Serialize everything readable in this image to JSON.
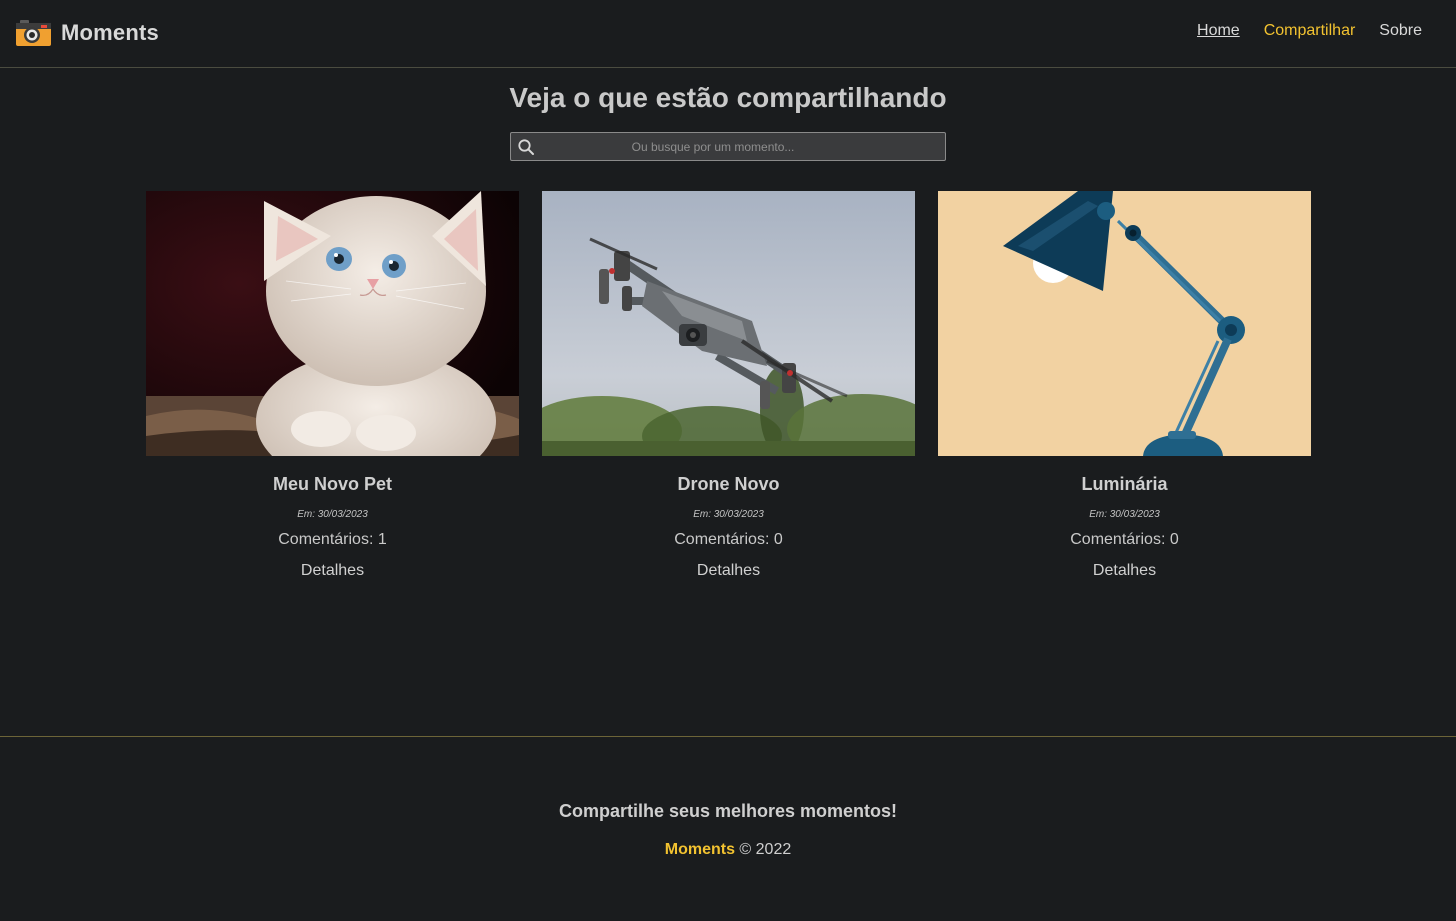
{
  "header": {
    "brand_name": "Moments",
    "nav": {
      "home": "Home",
      "share": "Compartilhar",
      "about": "Sobre"
    }
  },
  "main": {
    "title": "Veja o que estão compartilhando",
    "search": {
      "placeholder": "Ou busque por um momento...",
      "value": ""
    },
    "cards": [
      {
        "title": "Meu Novo Pet",
        "date": "Em: 30/03/2023",
        "comments": "Comentários: 1",
        "link": "Detalhes"
      },
      {
        "title": "Drone Novo",
        "date": "Em: 30/03/2023",
        "comments": "Comentários: 0",
        "link": "Detalhes"
      },
      {
        "title": "Luminária",
        "date": "Em: 30/03/2023",
        "comments": "Comentários: 0",
        "link": "Detalhes"
      }
    ]
  },
  "footer": {
    "tagline": "Compartilhe seus melhores momentos!",
    "brand": "Moments",
    "copyright": "© 2022"
  },
  "colors": {
    "background": "#1a1c1e",
    "accent": "#f2c230",
    "text": "#cfcfcf"
  },
  "icons": {
    "brand": "camera-icon",
    "search": "search-icon"
  }
}
